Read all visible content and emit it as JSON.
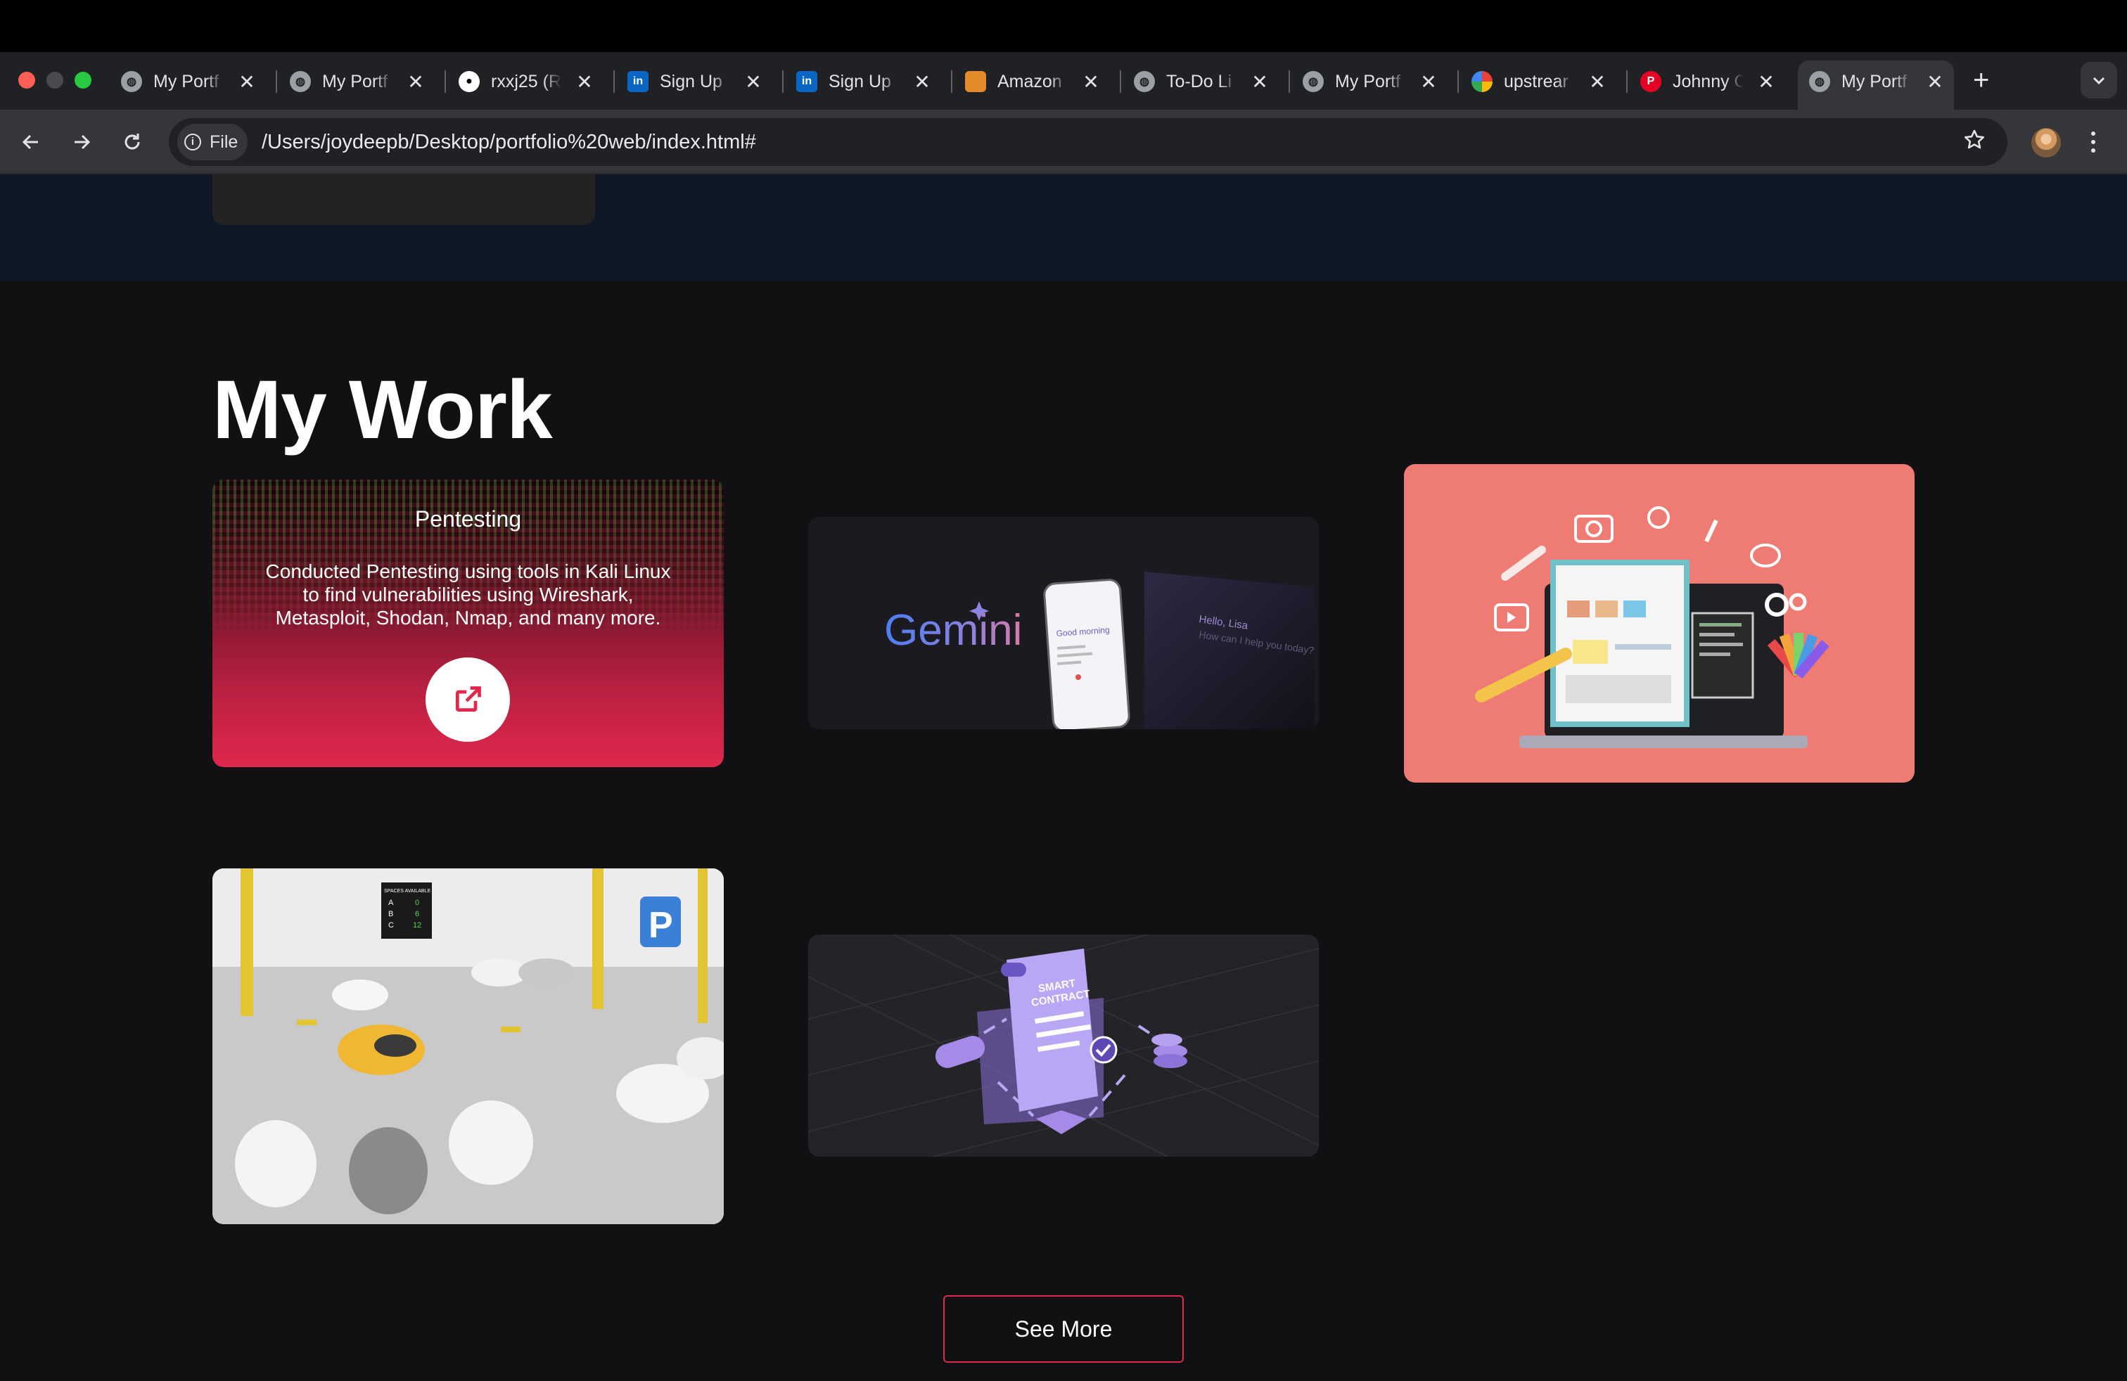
{
  "browser": {
    "tabs": [
      {
        "title": "My Portf",
        "icon": "globe-icon"
      },
      {
        "title": "My Portf",
        "icon": "globe-icon"
      },
      {
        "title": "rxxj25 (R",
        "icon": "github-icon"
      },
      {
        "title": "Sign Up",
        "icon": "linkedin-icon"
      },
      {
        "title": "Sign Up",
        "icon": "linkedin-icon"
      },
      {
        "title": "Amazon",
        "icon": "amazon-box-icon"
      },
      {
        "title": "To-Do Li",
        "icon": "globe-icon"
      },
      {
        "title": "My Portf",
        "icon": "globe-icon"
      },
      {
        "title": "upstrear",
        "icon": "google-icon"
      },
      {
        "title": "Johnny C",
        "icon": "pinterest-icon"
      },
      {
        "title": "My Portf",
        "icon": "globe-icon",
        "active": true
      }
    ],
    "chip_label": "File",
    "url": "/Users/joydeepb/Desktop/portfolio%20web/index.html#"
  },
  "page": {
    "section_title": "My Work",
    "cards": {
      "pentesting": {
        "title": "Pentesting",
        "description": "Conducted Pentesting using tools in Kali Linux to find vulnerabilities using Wireshark, Metasploit, Shodan, Nmap, and many more."
      },
      "gemini": {
        "logo_text": "Gemini",
        "phone_text": "Good morning",
        "screen_text_1": "Hello, Lisa",
        "screen_text_2": "How can I help you today?"
      },
      "parking": {
        "sign_title": "SPACES AVAILABLE",
        "rows": [
          {
            "label": "A",
            "value": "0"
          },
          {
            "label": "B",
            "value": "6"
          },
          {
            "label": "C",
            "value": "12"
          }
        ],
        "parking_letter": "P"
      },
      "smart_contract": {
        "line1": "SMART",
        "line2": "CONTRACT"
      }
    },
    "see_more_label": "See More"
  },
  "colors": {
    "accent": "#e0284e",
    "page_bg": "#111113",
    "hero_bg": "#0f1827",
    "web_card_bg": "#ee7b74"
  }
}
